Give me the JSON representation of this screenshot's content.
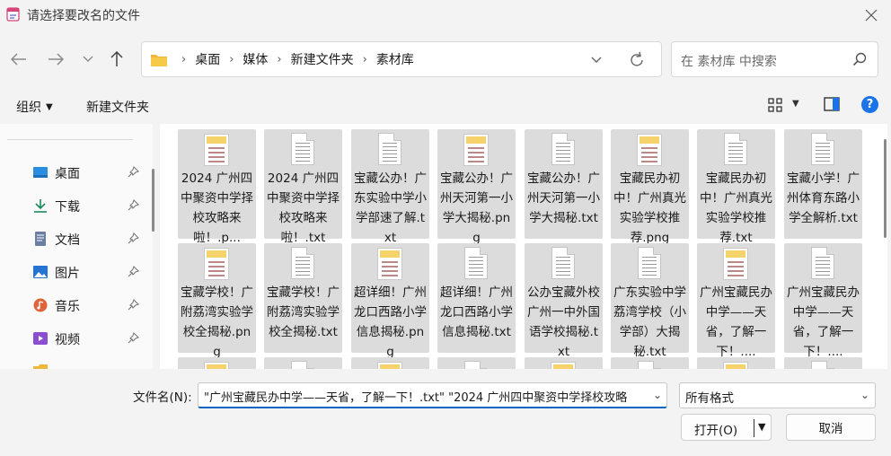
{
  "window": {
    "title": "请选择要改名的文件"
  },
  "nav": {
    "back": "←",
    "forward": "→",
    "recent": "⌄",
    "up": "↑"
  },
  "address": {
    "crumbs": [
      "桌面",
      "媒体",
      "新建文件夹",
      "素材库"
    ]
  },
  "search": {
    "placeholder": "在 素材库 中搜索"
  },
  "toolbar": {
    "organize": "组织",
    "new_folder": "新建文件夹",
    "help": "?"
  },
  "sidebar": {
    "items": [
      {
        "label": "桌面",
        "icon": "desktop-icon"
      },
      {
        "label": "下载",
        "icon": "download-icon"
      },
      {
        "label": "文档",
        "icon": "document-icon"
      },
      {
        "label": "图片",
        "icon": "pictures-icon"
      },
      {
        "label": "音乐",
        "icon": "music-icon"
      },
      {
        "label": "视频",
        "icon": "video-icon"
      }
    ]
  },
  "files": [
    {
      "name": "2024 广州四中聚资中学择校攻略来啦！.p...",
      "kind": "image"
    },
    {
      "name": "2024 广州四中聚资中学择校攻略来啦！.txt",
      "kind": "text"
    },
    {
      "name": "宝藏公办！广东实验中学小学部速了解.txt",
      "kind": "text"
    },
    {
      "name": "宝藏公办！广州天河第一小学大揭秘.png",
      "kind": "image"
    },
    {
      "name": "宝藏公办！广州天河第一小学大揭秘.txt",
      "kind": "text"
    },
    {
      "name": "宝藏民办初中！广州真光实验学校推荐.png",
      "kind": "image"
    },
    {
      "name": "宝藏民办初中！广州真光实验学校推荐.txt",
      "kind": "text"
    },
    {
      "name": "宝藏小学！广州体育东路小学全解析.txt",
      "kind": "text"
    },
    {
      "name": "宝藏学校！广附荔湾实验学校全揭秘.png",
      "kind": "image"
    },
    {
      "name": "宝藏学校！广附荔湾实验学校全揭秘.txt",
      "kind": "text"
    },
    {
      "name": "超详细！广州龙口西路小学信息揭秘.png",
      "kind": "image"
    },
    {
      "name": "超详细！广州龙口西路小学信息揭秘.txt",
      "kind": "text"
    },
    {
      "name": "公办宝藏外校广州一中外国语学校揭秘.txt",
      "kind": "text"
    },
    {
      "name": "广东实验中学荔湾学校（小学部）大揭秘.txt",
      "kind": "text"
    },
    {
      "name": "广州宝藏民办中学——天省，了解一下！....",
      "kind": "image"
    },
    {
      "name": "广州宝藏民办中学——天省，了解一下！....",
      "kind": "text"
    }
  ],
  "bottom": {
    "filename_label": "文件名(N):",
    "filename_value": "\"广州宝藏民办中学——天省，了解一下！.txt\" \"2024 广州四中聚资中学择校攻略",
    "filetype_value": "所有格式",
    "open_label": "打开(O)",
    "cancel_label": "取消"
  }
}
